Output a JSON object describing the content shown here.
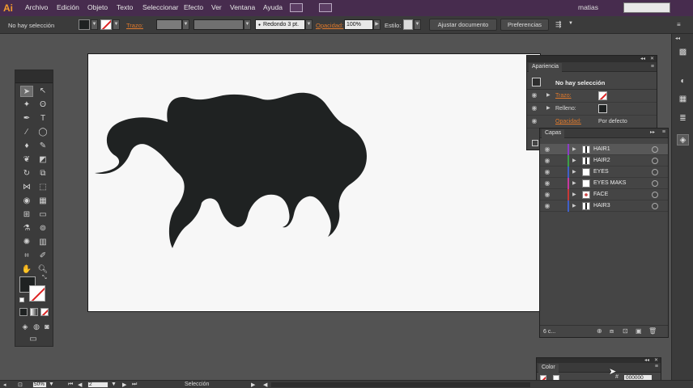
{
  "app": {
    "logo": "Ai",
    "brand_color": "#f29a2e"
  },
  "menubar": {
    "items": [
      "Archivo",
      "Edición",
      "Objeto",
      "Texto",
      "Seleccionar",
      "Efecto",
      "Ver",
      "Ventana",
      "Ayuda"
    ],
    "user": "matias",
    "bg_color": "#472c4e"
  },
  "controlbar": {
    "selection_status": "No hay selección",
    "stroke_label": "Trazo:",
    "brush_label": "Redondo 3 pt.",
    "opacity_label": "Opacidad:",
    "opacity_value": "100%",
    "style_label": "Estilo:",
    "document_setup_button": "Ajustar documento",
    "preferences_button": "Preferencias"
  },
  "canvas": {
    "artwork_fill": "#1f2222",
    "artboard_color": "#f7f7f7"
  },
  "appearance_panel": {
    "tab": "Apariencia",
    "header": "No hay selección",
    "rows": [
      {
        "label": "Trazo:",
        "highlighted": true
      },
      {
        "label": "Relleno:",
        "highlighted": false
      },
      {
        "label": "Opacidad:",
        "value": "Por defecto",
        "highlighted": true
      }
    ]
  },
  "layers_panel": {
    "tab": "Capas",
    "layers": [
      {
        "name": "HAIR1",
        "color": "#8c3cc8",
        "selected": true
      },
      {
        "name": "HAIR2",
        "color": "#3ca048",
        "selected": false
      },
      {
        "name": "EYES",
        "color": "#4060c8",
        "selected": false
      },
      {
        "name": "EYES MAKS",
        "color": "#c838a0",
        "selected": false
      },
      {
        "name": "FACE",
        "color": "#c83838",
        "selected": false
      },
      {
        "name": "HAIR3",
        "color": "#4060c8",
        "selected": false
      }
    ],
    "footer_count": "6 c..."
  },
  "color_panel": {
    "tab": "Color",
    "hex_label": "#",
    "hex_value": "000000"
  },
  "statusbar": {
    "zoom": "50%",
    "page": "2",
    "tool_label": "Selección"
  }
}
